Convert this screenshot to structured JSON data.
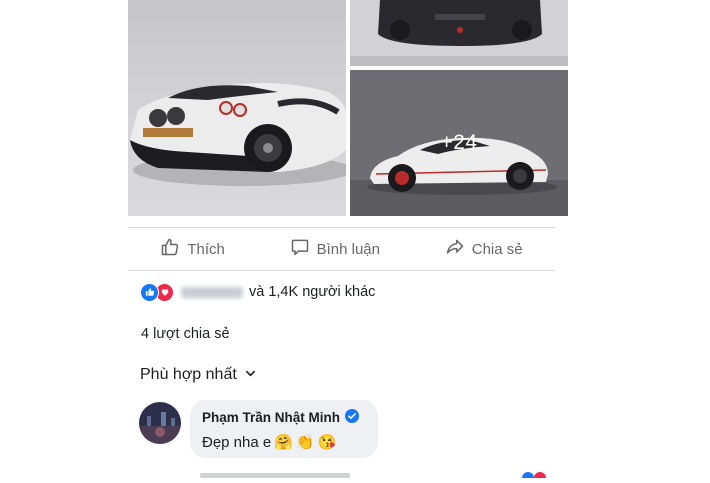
{
  "photos": {
    "more_count_label": "+24"
  },
  "actions": {
    "like_label": "Thích",
    "comment_label": "Bình luận",
    "share_label": "Chia sẻ"
  },
  "reactions": {
    "summary_text": "và 1,4K người khác"
  },
  "shares": {
    "text": "4 lượt chia sẻ"
  },
  "comments": {
    "sort_label": "Phù hợp nhất",
    "items": [
      {
        "author": "Phạm Trần Nhật Minh",
        "text": "Đẹp nha e",
        "emojis": [
          "🤗",
          "👏",
          "😘"
        ]
      }
    ]
  },
  "colors": {
    "like_blue": "#1877f2",
    "love_red": "#f02849",
    "muted_text": "#65676b",
    "bubble_bg": "#eef0f3"
  }
}
